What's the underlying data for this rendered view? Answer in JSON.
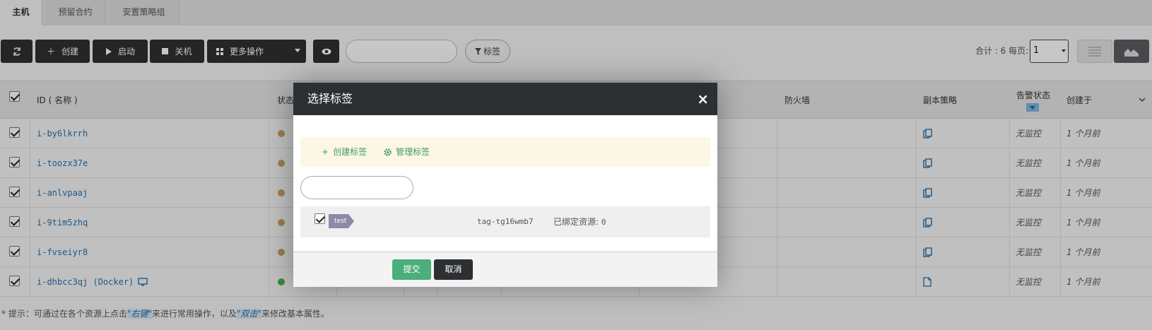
{
  "tabs": [
    {
      "label": "主机",
      "active": true
    },
    {
      "label": "预留合约",
      "active": false
    },
    {
      "label": "安置策略组",
      "active": false
    }
  ],
  "toolbar": {
    "create": "创建",
    "start": "启动",
    "shutdown": "关机",
    "more": "更多操作",
    "tag": "标签",
    "total_label": "合计 : 6  每页:",
    "per_page": "1"
  },
  "table": {
    "headers": {
      "id": "ID ( 名称 )",
      "status": "状态",
      "firewall": "防火墙",
      "replica": "副本策略",
      "alarm": "告警状态",
      "created": "创建于"
    },
    "rows": [
      {
        "id": "i-by6lkrrh",
        "status_color": "#c7a060",
        "alarm": "无监控",
        "created": "1 个月前"
      },
      {
        "id": "i-toozx37e",
        "status_color": "#c7a060",
        "alarm": "无监控",
        "created": "1 个月前"
      },
      {
        "id": "i-anlvpaaj",
        "status_color": "#c7a060",
        "alarm": "无监控",
        "created": "1 个月前"
      },
      {
        "id": "i-9tim5zhq",
        "status_color": "#c7a060",
        "alarm": "无监控",
        "created": "1 个月前"
      },
      {
        "id": "i-fvseiyr8",
        "status_color": "#c7a060",
        "alarm": "无监控",
        "created": "1 个月前"
      },
      {
        "id": "i-dhbcc3qj (Docker)",
        "status_color": "#4caf50",
        "alarm": "无监控",
        "created": "1 个月前"
      }
    ]
  },
  "tip": {
    "prefix": "* 提示：可通过在各个资源上点击",
    "right_click": "\"右键\"",
    "middle": "来进行常用操作，以及",
    "double_click": "\"双击\"",
    "suffix": "来修改基本属性。"
  },
  "modal": {
    "title": "选择标签",
    "close": "×",
    "create_tag": "创建标签",
    "manage_tag": "管理标签",
    "tag": {
      "name": "test",
      "id": "tag-tg16wmb7",
      "bound_label": "已绑定资源:",
      "bound_count": "0"
    },
    "submit": "提交",
    "cancel": "取消"
  }
}
